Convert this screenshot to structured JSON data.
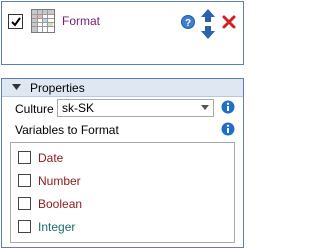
{
  "activity": {
    "title": "Format",
    "checked": true,
    "icons": {
      "grid": "spreadsheet-grid-icon",
      "help": "help-icon",
      "move": "move-up-down-icon",
      "delete": "delete-icon"
    }
  },
  "properties": {
    "title": "Properties",
    "culture_label": "Culture",
    "culture_value": "sk-SK",
    "variables_label": "Variables to Format",
    "variables": [
      {
        "label": "Date",
        "checked": false,
        "color": "#8b1a1a"
      },
      {
        "label": "Number",
        "checked": false,
        "color": "#8b1a1a"
      },
      {
        "label": "Boolean",
        "checked": false,
        "color": "#8b1a1a"
      },
      {
        "label": "Integer",
        "checked": false,
        "color": "#1a6b6b"
      }
    ]
  },
  "colors": {
    "accent_border": "#5d7fb8",
    "header_bg": "#dfe7f3",
    "title_purple": "#7a1a7a",
    "info_blue": "#1f6fc9",
    "delete_red": "#d42020"
  }
}
